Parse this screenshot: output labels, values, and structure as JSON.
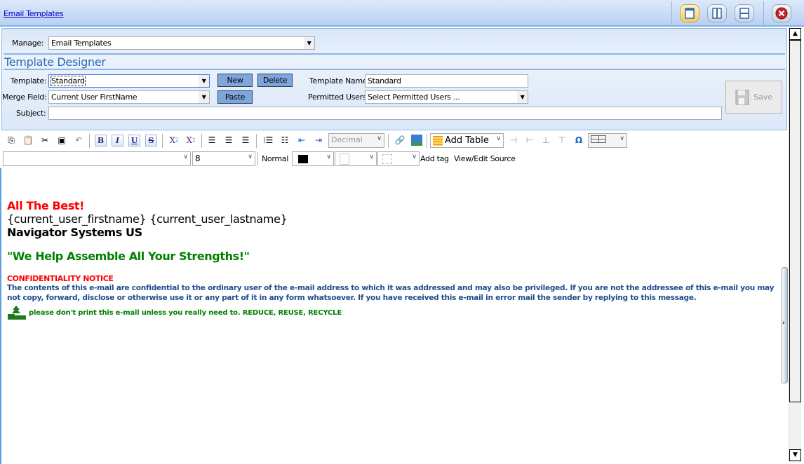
{
  "titlebar": {
    "link": "Email Templates",
    "buttons": [
      "layout-single-icon",
      "layout-columns-icon",
      "layout-rows-icon",
      "close-icon"
    ]
  },
  "manage": {
    "label": "Manage:",
    "value": "Email Templates"
  },
  "designer": {
    "title": "Template Designer",
    "template_label": "Template:",
    "template_value": "Standard",
    "new_label": "New",
    "delete_label": "Delete",
    "merge_label": "Merge Field:",
    "merge_value": "Current User FirstName",
    "paste_label": "Paste",
    "name_label": "Template Name",
    "name_value": "Standard",
    "users_label": "Permitted Users",
    "users_value": "Select Permitted Users ...",
    "subject_label": "Subject:",
    "subject_value": "",
    "save_label": "Save"
  },
  "toolbar": {
    "list_style": "Decimal",
    "add_table": "Add Table",
    "font": "",
    "size": "8",
    "format": "Normal",
    "add_tag": "Add tag",
    "view_source": "View/Edit Source",
    "bold": "B",
    "italic": "I",
    "underline": "U",
    "strike": "S"
  },
  "content": {
    "closing": "All The Best!",
    "name_line": "{current_user_firstname} {current_user_lastname}",
    "company": "Navigator Systems US",
    "slogan": "\"We Help Assemble All Your Strengths!\"",
    "notice_title": "CONFIDENTIALITY NOTICE",
    "notice_body": "The contents of this e-mail are confidential to the ordinary user of the e-mail address to which it was addressed and may also be privileged. If you are not the addressee of this e-mail you may not copy, forward, disclose or otherwise use it or any part of it in any form whatsoever. If you have received this e-mail in error mail the sender by replying to this message.",
    "eco": "please don't print this e-mail unless you really need to. REDUCE, REUSE, RECYCLE"
  },
  "colors": {
    "red": "#ff0000",
    "green": "#008000",
    "notice_blue": "#1f4e8c",
    "accent": "#7ea6dd"
  }
}
